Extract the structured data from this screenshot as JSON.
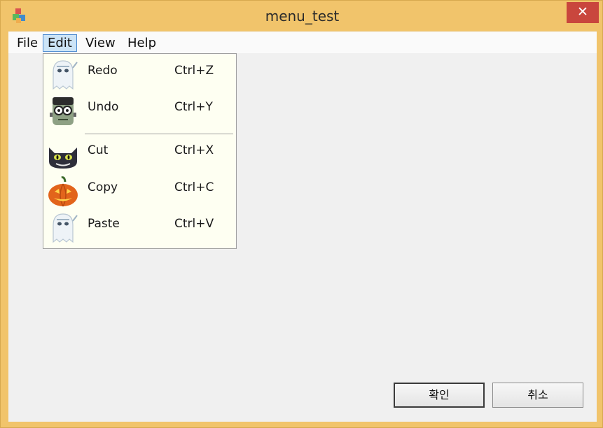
{
  "window": {
    "title": "menu_test",
    "close_label": "✕"
  },
  "menubar": {
    "items": [
      "File",
      "Edit",
      "View",
      "Help"
    ],
    "active": "Edit"
  },
  "edit_menu": {
    "items": [
      {
        "label": "Redo",
        "shortcut": "Ctrl+Z",
        "icon": "ghost-icon"
      },
      {
        "label": "Undo",
        "shortcut": "Ctrl+Y",
        "icon": "zombie-face-icon"
      },
      {
        "label": "Cut",
        "shortcut": "Ctrl+X",
        "icon": "black-cat-icon"
      },
      {
        "label": "Copy",
        "shortcut": "Ctrl+C",
        "icon": "pumpkin-icon"
      },
      {
        "label": "Paste",
        "shortcut": "Ctrl+V",
        "icon": "ghost-icon"
      }
    ]
  },
  "buttons": {
    "ok": "확인",
    "cancel": "취소"
  },
  "colors": {
    "frame": "#f1c46b",
    "client": "#f0f0f0",
    "menu_bg": "#fefff2",
    "highlight": "#cce4f7",
    "close": "#c9463d"
  }
}
